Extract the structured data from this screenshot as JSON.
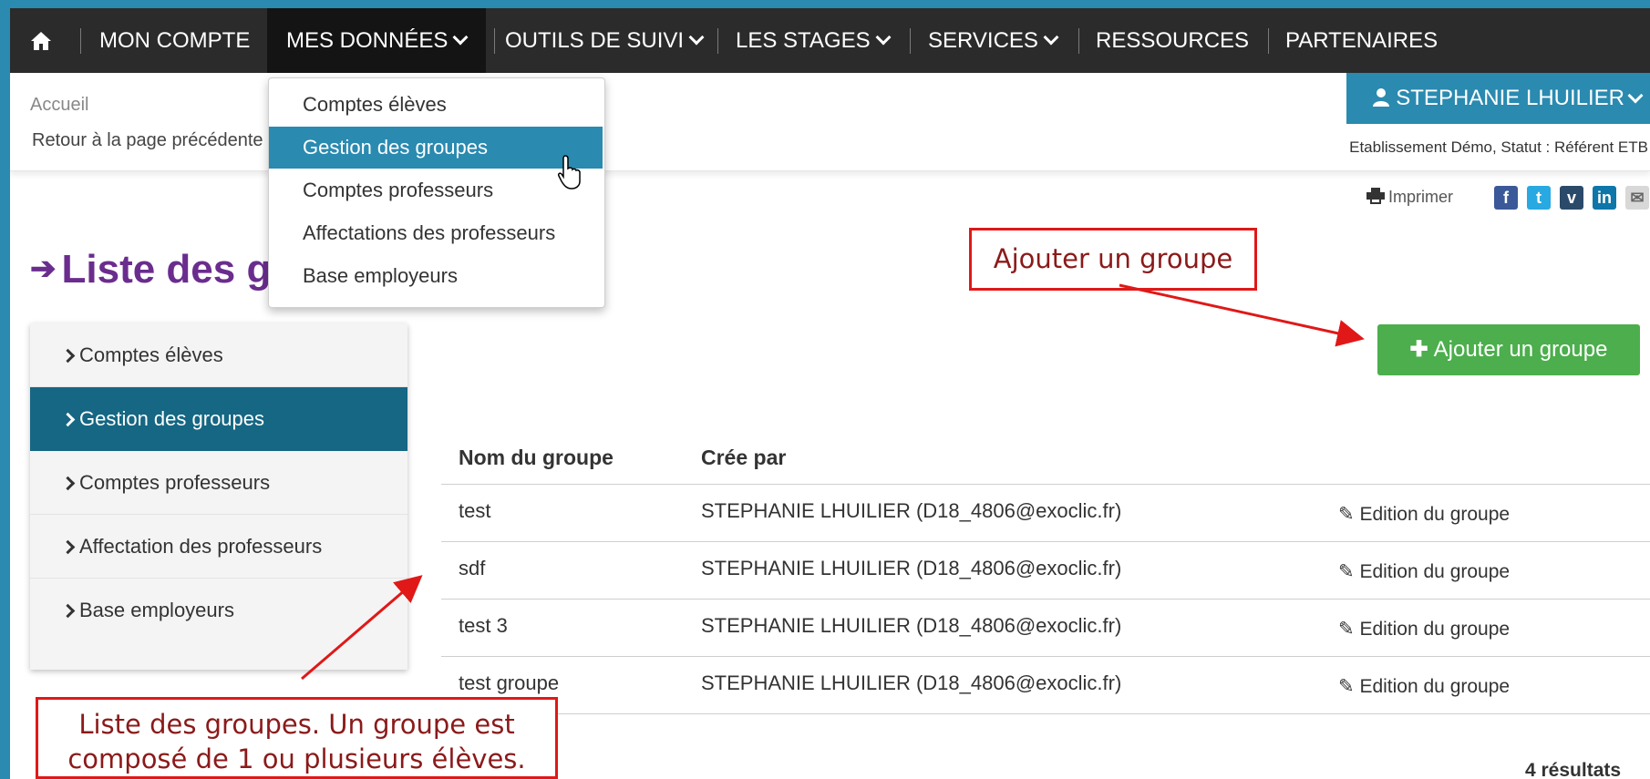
{
  "nav": {
    "home_icon": "home-icon",
    "items": [
      {
        "label": "MON COMPTE"
      },
      {
        "label": "MES DONNÉES"
      },
      {
        "label": "OUTILS DE SUIVI"
      },
      {
        "label": "LES STAGES"
      },
      {
        "label": "SERVICES"
      },
      {
        "label": "RESSOURCES"
      },
      {
        "label": "PARTENAIRES"
      }
    ]
  },
  "dropdown": {
    "items": [
      {
        "label": "Comptes élèves"
      },
      {
        "label": "Gestion des groupes"
      },
      {
        "label": "Comptes professeurs"
      },
      {
        "label": "Affectations des professeurs"
      },
      {
        "label": "Base employeurs"
      }
    ],
    "active_index": 1
  },
  "header": {
    "breadcrumb": "Accueil",
    "back_link": "Retour à la page précédente",
    "user_name": "STEPHANIE LHUILIER",
    "status": "Etablissement Démo, Statut : Référent ETB"
  },
  "share": {
    "print_label": "Imprimer",
    "icons": [
      "facebook-icon",
      "twitter-icon",
      "viadeo-icon",
      "linkedin-icon",
      "mail-icon"
    ]
  },
  "page": {
    "title": "Liste des groupes"
  },
  "sidebar": {
    "items": [
      {
        "label": "Comptes élèves"
      },
      {
        "label": "Gestion des groupes"
      },
      {
        "label": "Comptes professeurs"
      },
      {
        "label": "Affectation des professeurs"
      },
      {
        "label": "Base employeurs"
      }
    ],
    "active_index": 1
  },
  "actions": {
    "add_group": "Ajouter un groupe"
  },
  "table": {
    "columns": [
      "Nom du groupe",
      "Crée par"
    ],
    "rows": [
      {
        "name": "test",
        "creator": "STEPHANIE LHUILIER (D18_4806@exoclic.fr)",
        "edit": "Edition du groupe"
      },
      {
        "name": "sdf",
        "creator": "STEPHANIE LHUILIER (D18_4806@exoclic.fr)",
        "edit": "Edition du groupe"
      },
      {
        "name": "test 3",
        "creator": "STEPHANIE LHUILIER (D18_4806@exoclic.fr)",
        "edit": "Edition du groupe"
      },
      {
        "name": "test groupe",
        "creator": "STEPHANIE LHUILIER (D18_4806@exoclic.fr)",
        "edit": "Edition du groupe"
      }
    ],
    "results": "4 résultats"
  },
  "callouts": {
    "add_group": "Ajouter un groupe",
    "group_list_line1": "Liste des groupes. Un groupe est",
    "group_list_line2": "composé de 1 ou plusieurs élèves."
  },
  "colors": {
    "nav_bg": "#2b2b2b",
    "accent": "#2a8ab0",
    "sidebar_active": "#156783",
    "title": "#6a2d8e",
    "add_button": "#4cae4c",
    "callout_border": "#e01818"
  }
}
